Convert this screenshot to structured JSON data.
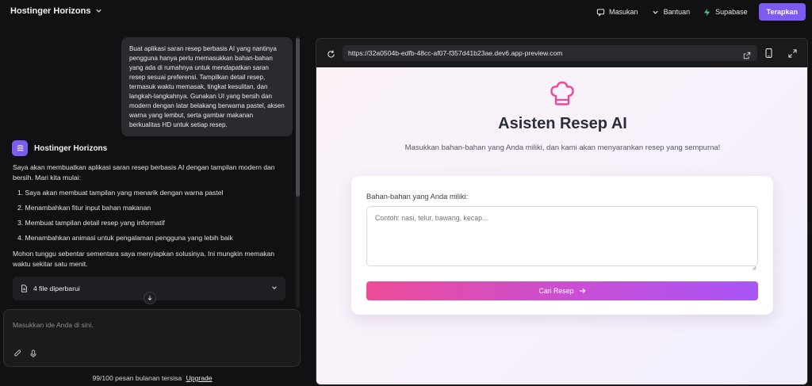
{
  "topbar": {
    "brand": "Hostinger Horizons",
    "feedback": "Masukan",
    "help": "Bantuan",
    "supabase": "Supabase",
    "deploy": "Terapkan"
  },
  "chat": {
    "user_message": "Buat aplikasi saran resep berbasis AI yang nantinya pengguna hanya perlu memasukkan bahan-bahan yang ada di rumahnya untuk mendapatkan saran resep sesuai preferensi. Tampilkan detail resep, termasuk waktu memasak, tingkat kesulitan, dan langkah-langkahnya. Gunakan UI yang bersih dan modern dengan latar belakang berwarna pastel, aksen warna yang lembut, serta gambar makanan berkualitas HD untuk setiap resep.",
    "assistant_name": "Hostinger Horizons",
    "assistant_intro": "Saya akan membuatkan aplikasi saran resep berbasis AI dengan tampilan modern dan bersih. Mari kita mulai:",
    "steps": [
      "1. Saya akan membuat tampilan yang menarik dengan warna pastel",
      "2. Menambahkan fitur input bahan makanan",
      "3. Membuat tampilan detail resep yang informatif",
      "4. Menambahkan animasi untuk pengalaman pengguna yang lebih baik"
    ],
    "assistant_outro": "Mohon tunggu sebentar sementara saya menyiapkan solusinya. Ini mungkin memakan waktu sekitar satu menit.",
    "files_updated": "4 file diperbarui",
    "input_placeholder": "Masukkan ide Anda di sini.",
    "quota": "99/100 pesan bulanan tersisa",
    "upgrade": "Upgrade"
  },
  "preview": {
    "url": "https://32a0504b-edfb-48cc-af07-f357d41b23ae.dev6.app-preview.com",
    "app_title": "Asisten Resep AI",
    "app_subtitle": "Masukkan bahan-bahan yang Anda miliki, dan kami akan menyarankan resep yang sempurna!",
    "ingredients_label": "Bahan-bahan yang Anda miliki:",
    "ingredients_placeholder": "Contoh: nasi, telur, bawang, kecap...",
    "search_button": "Cari Resep"
  },
  "colors": {
    "accent": "#7c5cf0",
    "supabase_green": "#3ecf8e",
    "chef_pink": "#ec4899",
    "button_gradient_start": "#ec4c97",
    "button_gradient_end": "#a855f7"
  }
}
